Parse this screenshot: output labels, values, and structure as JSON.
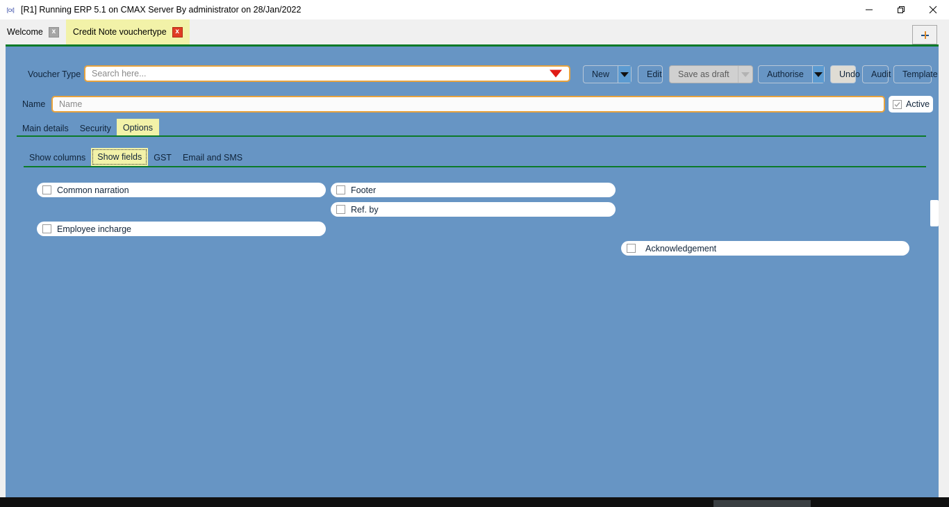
{
  "window": {
    "app_icon": "cx-logo-icon",
    "title": "[R1] Running ERP 5.1 on CMAX Server By administrator on 28/Jan/2022",
    "controls": {
      "minimize": "minimize-icon",
      "maximize": "restore-icon",
      "close": "close-icon"
    }
  },
  "tabstrip": {
    "tabs": [
      {
        "label": "Welcome",
        "active": false,
        "close": "x"
      },
      {
        "label": "Credit Note vouchertype",
        "active": true,
        "close": "x"
      }
    ],
    "new_tab_label": "+"
  },
  "form": {
    "voucher_type_label": "Voucher Type",
    "search_placeholder": "Search here...",
    "search_value": "",
    "name_label": "Name",
    "name_placeholder": "Name",
    "name_value": "",
    "active_label": "Active",
    "active_checked": true
  },
  "toolbar": {
    "new_label": "New",
    "edit_label": "Edit",
    "save_as_draft_label": "Save as draft",
    "authorise_label": "Authorise",
    "undo_label": "Undo",
    "audit_label": "Audit",
    "template_label": "Template"
  },
  "main_tabs": [
    {
      "label": "Main details",
      "selected": false
    },
    {
      "label": "Security",
      "selected": false
    },
    {
      "label": "Options",
      "selected": true
    }
  ],
  "sub_tabs": [
    {
      "label": "Show columns",
      "selected": false
    },
    {
      "label": "Show fields",
      "selected": true,
      "focused": true
    },
    {
      "label": "GST",
      "selected": false
    },
    {
      "label": "Email and SMS",
      "selected": false
    }
  ],
  "fields": {
    "column_left": [
      {
        "label": "Common narration",
        "checked": false
      },
      {
        "label": "Employee incharge",
        "checked": false
      }
    ],
    "column_mid": [
      {
        "label": "Footer",
        "checked": false
      },
      {
        "label": "Ref. by",
        "checked": false
      }
    ],
    "column_right": [
      {
        "label": "Acknowledgement",
        "checked": false
      }
    ]
  },
  "colors": {
    "workspace_bg": "#6795c4",
    "accent_green": "#0c7a28",
    "highlight_yellow": "#f2f2a8",
    "field_border_orange": "#e8a33d",
    "caret_red": "#e01b17",
    "close_red": "#e03c24"
  }
}
